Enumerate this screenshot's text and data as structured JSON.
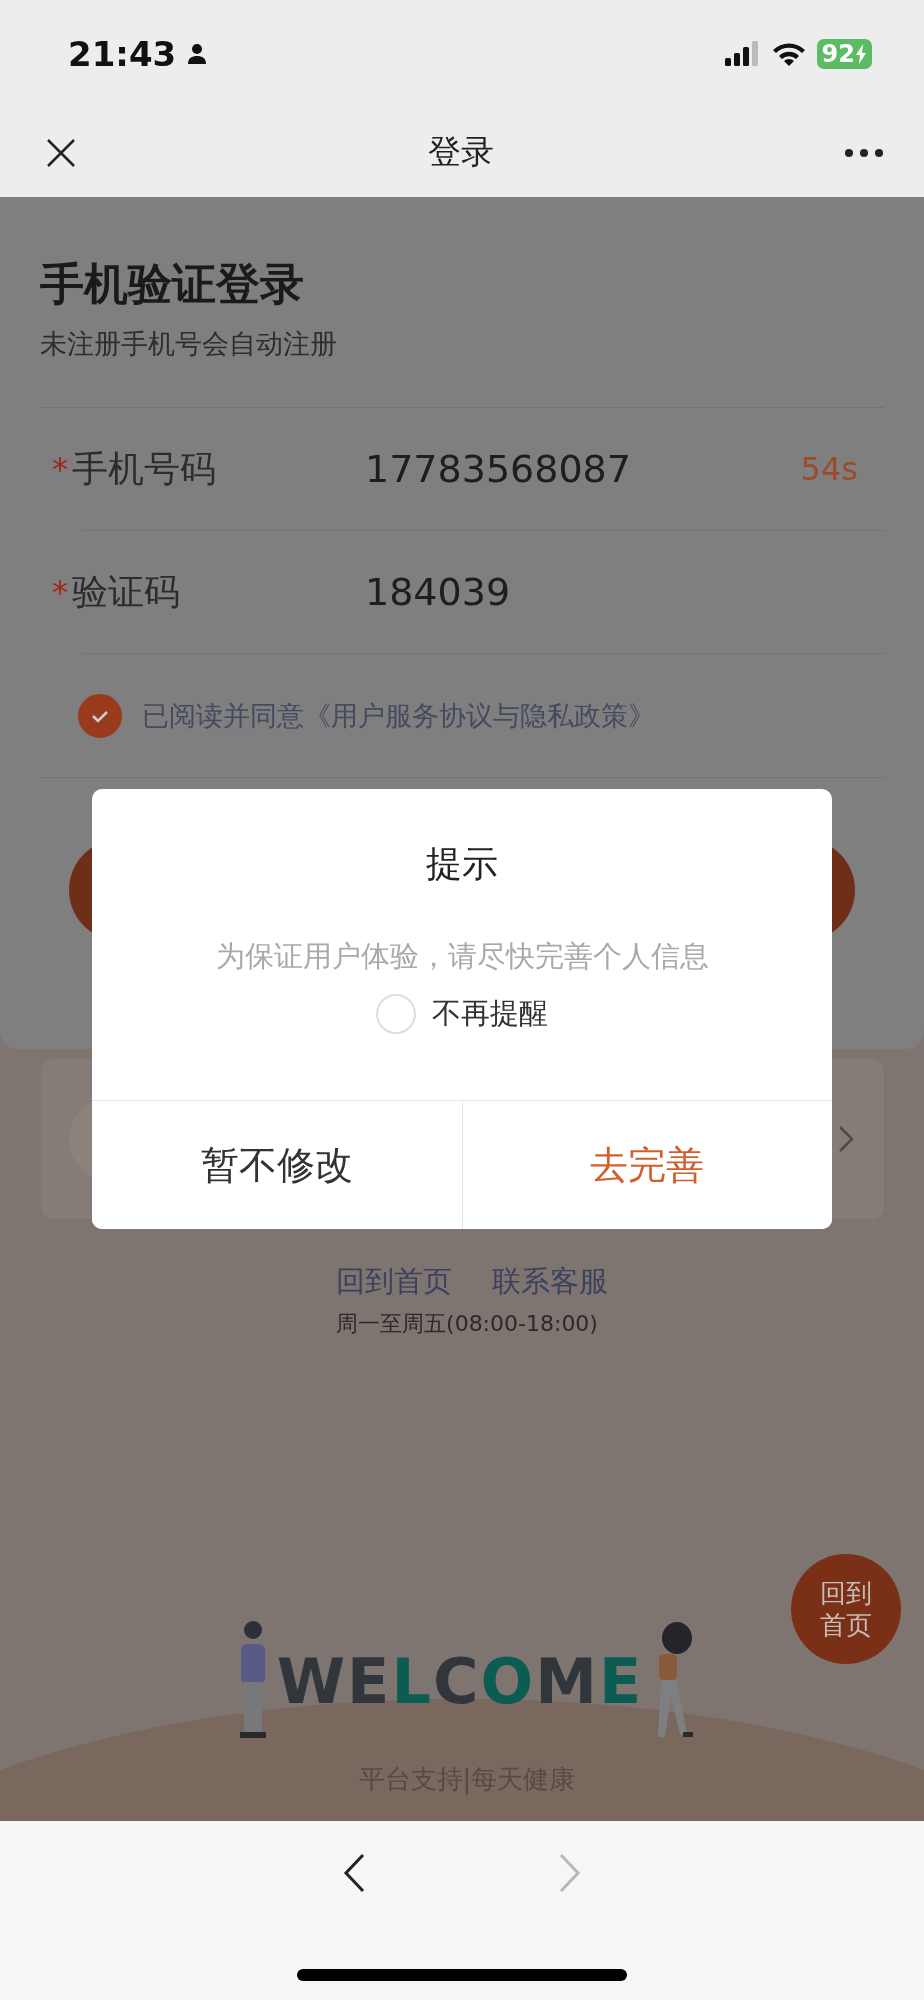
{
  "status_bar": {
    "time": "21:43",
    "battery": "92"
  },
  "nav": {
    "title": "登录"
  },
  "login": {
    "title": "手机验证登录",
    "subtitle": "未注册手机号会自动注册",
    "fields": [
      {
        "label": "手机号码",
        "required_mark": "*",
        "value": "17783568087",
        "countdown": "54s"
      },
      {
        "label": "验证码",
        "required_mark": "*",
        "value": "184039"
      }
    ],
    "agreement": {
      "checked": true,
      "text": "已阅读并同意《用户服务协议与隐私政策》"
    }
  },
  "links": [
    "回到首页",
    "联系客服"
  ],
  "hours": "周一至周五(08:00-18:00)",
  "float_button": [
    "回到",
    "首页"
  ],
  "illustration": {
    "title": "WELCOME"
  },
  "footer": "平台支持|每天健康",
  "dialog": {
    "title": "提示",
    "message": "为保证用户体验，请尽快完善个人信息",
    "option": {
      "label": "不再提醒",
      "checked": false
    },
    "buttons": [
      {
        "label": "暂不修改",
        "kind": "secondary"
      },
      {
        "label": "去完善",
        "kind": "primary"
      }
    ]
  },
  "toolbar": [
    {
      "kind": "back",
      "disabled": false
    },
    {
      "kind": "forward",
      "disabled": true
    }
  ]
}
